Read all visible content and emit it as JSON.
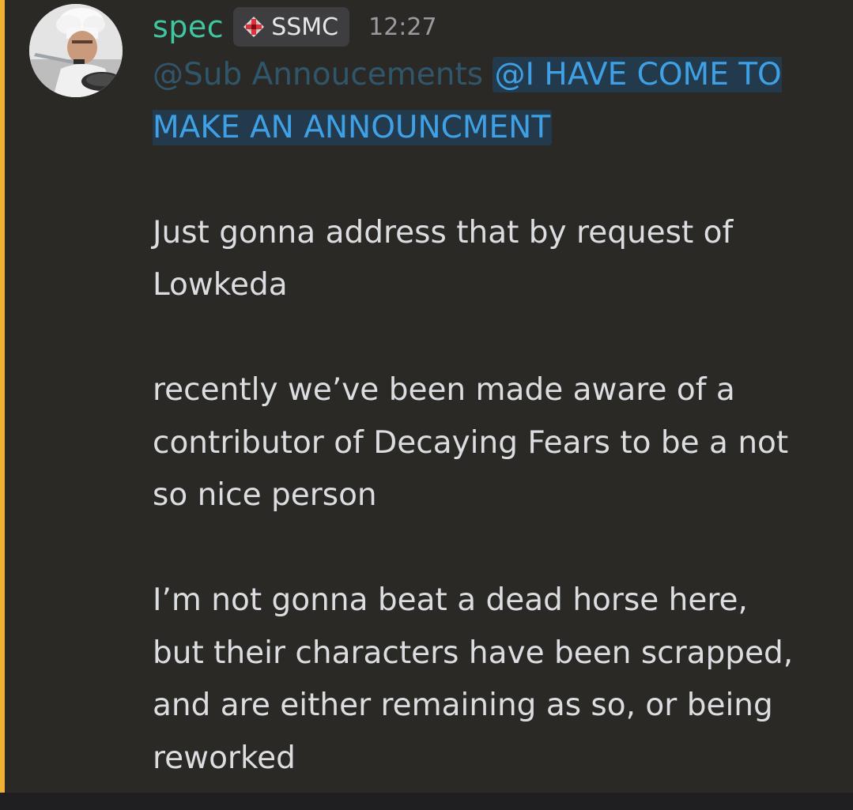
{
  "message": {
    "author": "spec",
    "tag": "SSMC",
    "tag_icon": "red-diamond-icon",
    "timestamp": "12:27",
    "mention_role": "@Sub Annoucements",
    "mention_highlight": "@I HAVE COME TO MAKE AN ANNOUNCMENT",
    "paragraphs": [
      "Just gonna address that by request of Lowkeda",
      "recently we’ve been made aware of a contributor of Decaying Fears to be a not so nice person",
      "I’m not gonna beat a dead horse here, but their characters have been scrapped, and are either remaining as so, or being reworked"
    ]
  },
  "colors": {
    "accent_bar": "#f0b232",
    "username": "#3ec7a0",
    "mention": "#3fa0e6",
    "mention_bg": "#233a4d",
    "background": "#2b2926"
  }
}
